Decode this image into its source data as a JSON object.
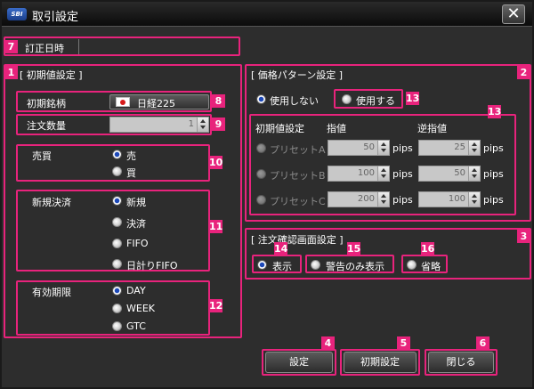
{
  "window": {
    "title": "取引設定",
    "logo_text": "SBI",
    "close_glyph": "✕"
  },
  "correction_date": {
    "label": "訂正日時",
    "value": ""
  },
  "initial_settings": {
    "title": "[ 初期値設定 ]",
    "symbol_label": "初期銘柄",
    "symbol_value": "日経225",
    "quantity_label": "注文数量",
    "quantity_value": "1",
    "side": {
      "label": "売買",
      "options": [
        "売",
        "買"
      ],
      "selected": "売"
    },
    "new_settle": {
      "label": "新規決済",
      "options": [
        "新規",
        "決済",
        "FIFO",
        "日計りFIFO"
      ],
      "selected": "新規"
    },
    "expiry": {
      "label": "有効期限",
      "options": [
        "DAY",
        "WEEK",
        "GTC"
      ],
      "selected": "DAY"
    }
  },
  "price_pattern": {
    "title": "[ 価格パターン設定 ]",
    "options": [
      "使用しない",
      "使用する"
    ],
    "selected": "使用しない",
    "headers": {
      "initial": "初期値設定",
      "limit": "指値",
      "stop": "逆指値"
    },
    "presets": [
      {
        "name": "プリセットA",
        "limit": "50",
        "stop": "25"
      },
      {
        "name": "プリセットB",
        "limit": "100",
        "stop": "50"
      },
      {
        "name": "プリセットC",
        "limit": "200",
        "stop": "100"
      }
    ],
    "unit": "pips"
  },
  "confirm_screen": {
    "title": "[ 注文確認画面設定 ]",
    "options": [
      "表示",
      "警告のみ表示",
      "省略"
    ],
    "selected": "表示"
  },
  "buttons": {
    "apply": "設定",
    "reset": "初期設定",
    "close": "閉じる"
  },
  "badges": [
    "1",
    "2",
    "3",
    "4",
    "5",
    "6",
    "7",
    "8",
    "9",
    "10",
    "11",
    "12",
    "13",
    "13",
    "14",
    "15",
    "16"
  ],
  "colors": {
    "badge": "#e8237c",
    "background": "#2d2d2d",
    "radio_checked": "#1c48b8"
  }
}
